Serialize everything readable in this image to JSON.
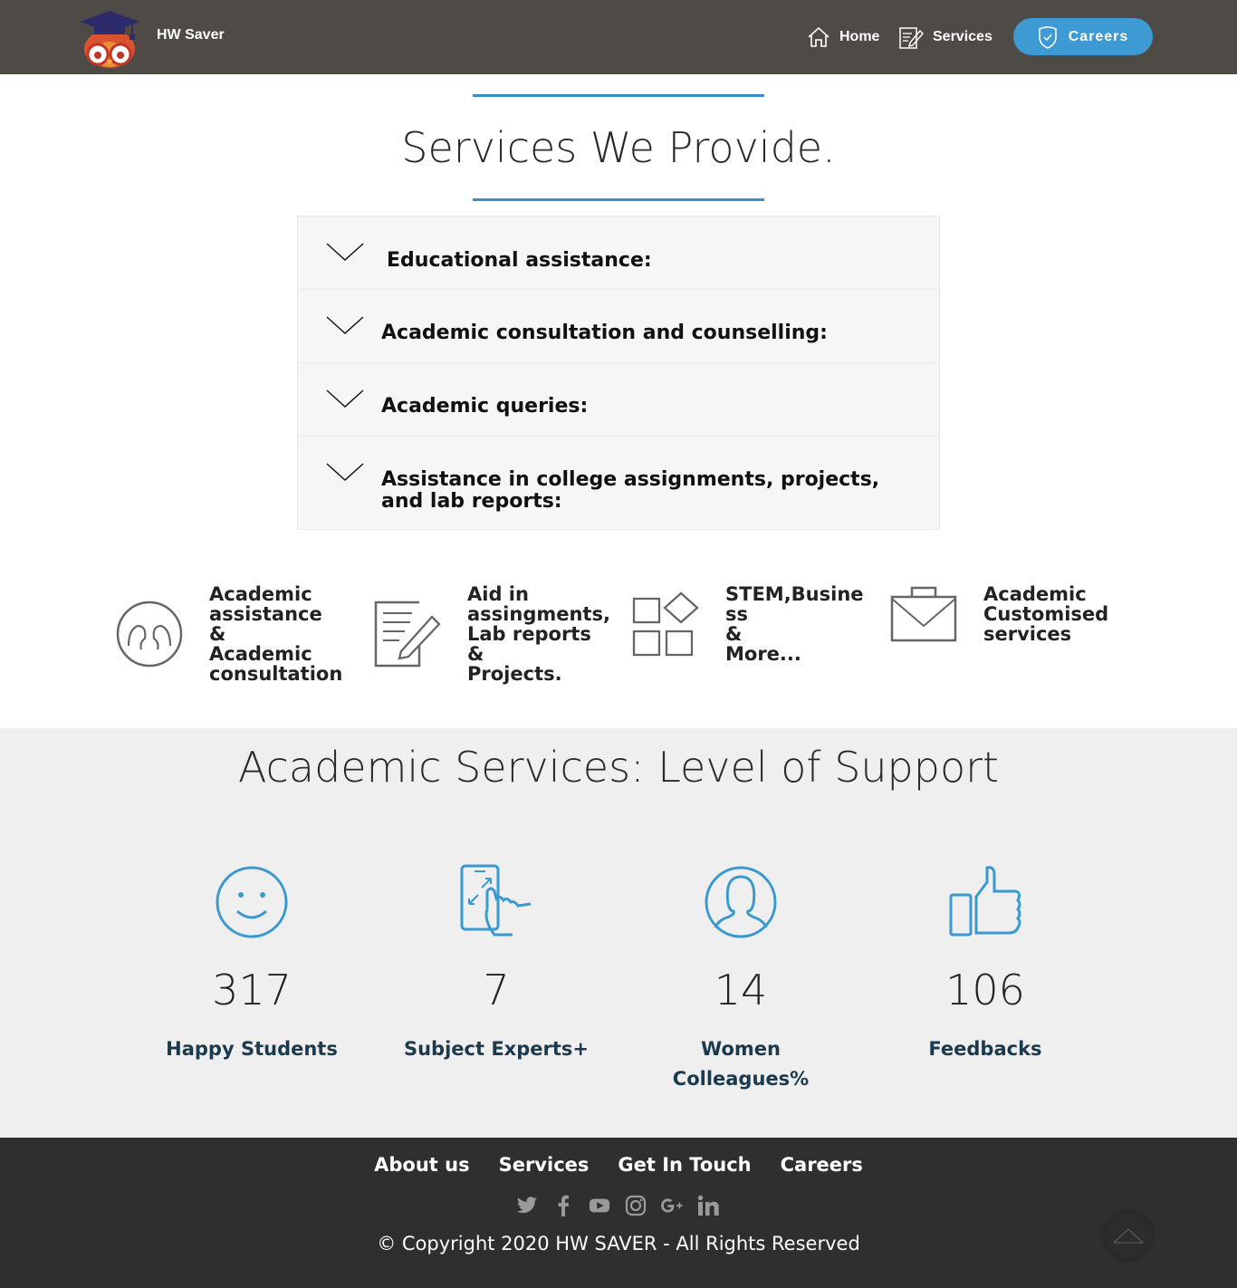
{
  "header": {
    "brand": "HW Saver",
    "nav": {
      "home": "Home",
      "services": "Services",
      "careers": "Careers"
    },
    "accent_color": "#3e9ad3",
    "bg_color": "#4e4a45"
  },
  "services": {
    "title": "Services We Provide.",
    "accordion": [
      {
        "label": "Educational assistance:"
      },
      {
        "label": "Academic consultation and counselling:"
      },
      {
        "label": "Academic queries:"
      },
      {
        "label": "Assistance in college assignments, projects, and lab reports:"
      }
    ]
  },
  "features": [
    {
      "icon": "people-circle-icon",
      "text": "Academic\nassistance\n&\nAcademic\nconsultation"
    },
    {
      "icon": "document-edit-icon",
      "text": "Aid in\nassingments,\nLab reports\n&\nProjects."
    },
    {
      "icon": "apps-grid-icon",
      "text": "STEM,Busine\nss\n&\nMore..."
    },
    {
      "icon": "briefcase-icon",
      "text": "Academic\nCustomised\nservices"
    }
  ],
  "stats": {
    "title": "Academic Services: Level of Support",
    "items": [
      {
        "icon": "smiley-icon",
        "value": "317",
        "label": "Happy Students"
      },
      {
        "icon": "phone-touch-icon",
        "value": "7",
        "label": "Subject Experts+"
      },
      {
        "icon": "woman-circle-icon",
        "value": "14",
        "label": "Women Colleagues%"
      },
      {
        "icon": "thumbs-up-icon",
        "value": "106",
        "label": "Feedbacks"
      }
    ],
    "icon_color": "#3a9ad0"
  },
  "footer": {
    "links": [
      "About us",
      "Services",
      "Get In Touch",
      "Careers"
    ],
    "social": [
      "twitter-icon",
      "facebook-icon",
      "youtube-icon",
      "instagram-icon",
      "google-plus-icon",
      "linkedin-icon"
    ],
    "copyright": "© Copyright 2020 HW SAVER - All Rights Reserved"
  }
}
